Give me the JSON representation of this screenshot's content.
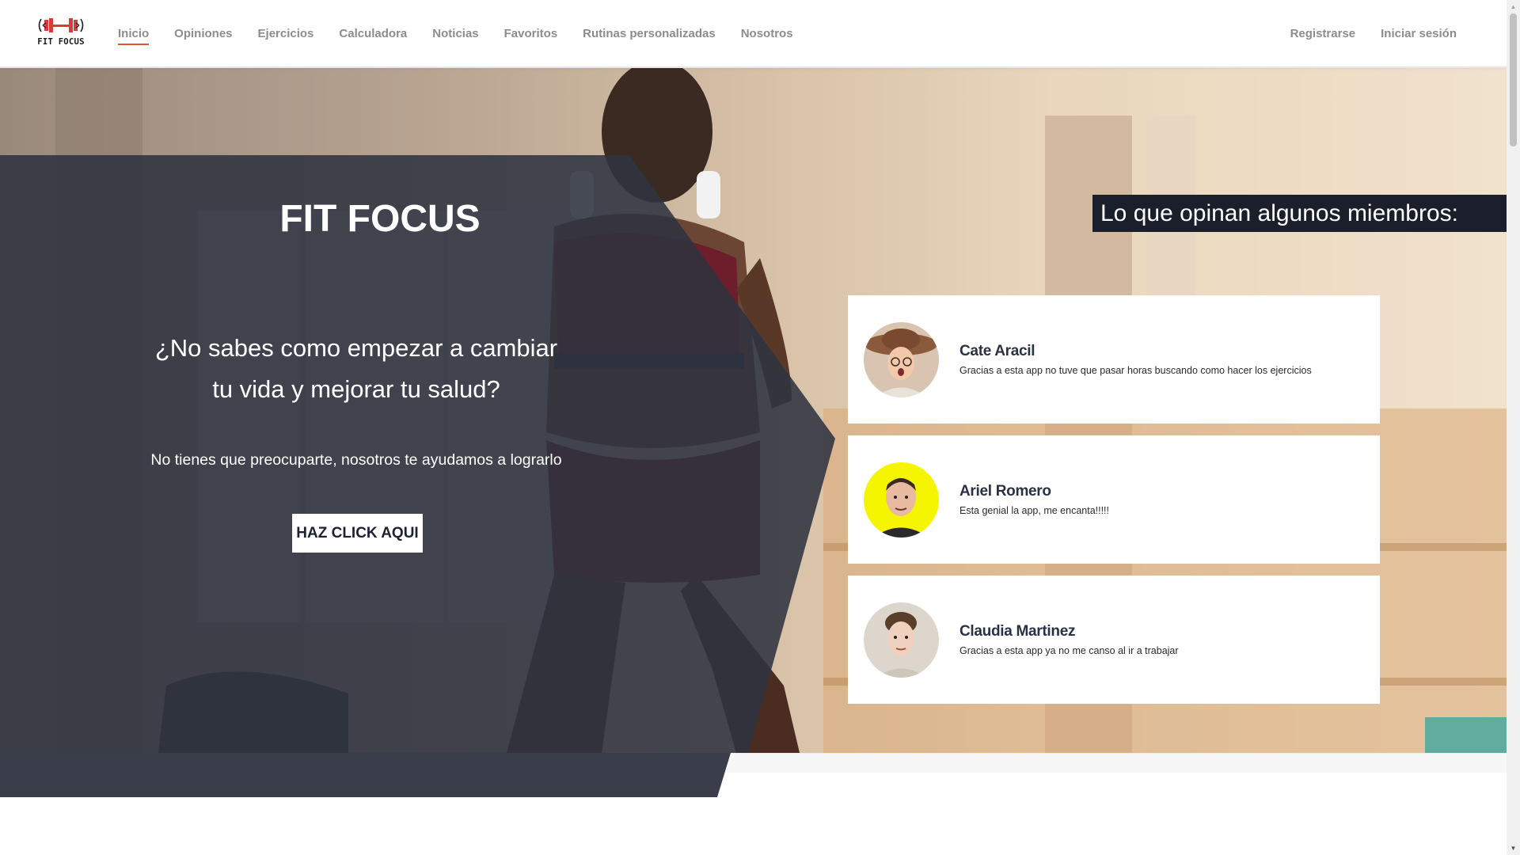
{
  "brand": {
    "logo_text": "FIT FOCUS"
  },
  "nav": {
    "items": [
      {
        "label": "Inicio",
        "active": true
      },
      {
        "label": "Opiniones"
      },
      {
        "label": "Ejercicios"
      },
      {
        "label": "Calculadora"
      },
      {
        "label": "Noticias"
      },
      {
        "label": "Favoritos"
      },
      {
        "label": "Rutinas personalizadas"
      },
      {
        "label": "Nosotros"
      }
    ],
    "register_label": "Registrarse",
    "login_label": "Iniciar sesión"
  },
  "hero": {
    "title": "FIT FOCUS",
    "question_line1": "¿No sabes como empezar a cambiar",
    "question_line2": "tu vida y mejorar tu salud?",
    "subtitle": "No tienes que preocuparte, nosotros te ayudamos a lograrlo",
    "cta_label": "HAZ CLICK AQUI"
  },
  "opinions": {
    "title": "Lo que opinan algunos miembros:",
    "items": [
      {
        "name": "Cate Aracil",
        "text": "Gracias a esta app no tuve que pasar horas buscando como hacer los ejercicios"
      },
      {
        "name": "Ariel Romero",
        "text": "Esta genial la app, me encanta!!!!!"
      },
      {
        "name": "Claudia Martinez",
        "text": "Gracias a esta app ya no me canso al ir a trabajar"
      }
    ]
  },
  "colors": {
    "accent": "#e0553a",
    "dark_panel": "#373b47",
    "opinions_title_bg": "#1a1f2b",
    "name_color": "#2a3144"
  }
}
